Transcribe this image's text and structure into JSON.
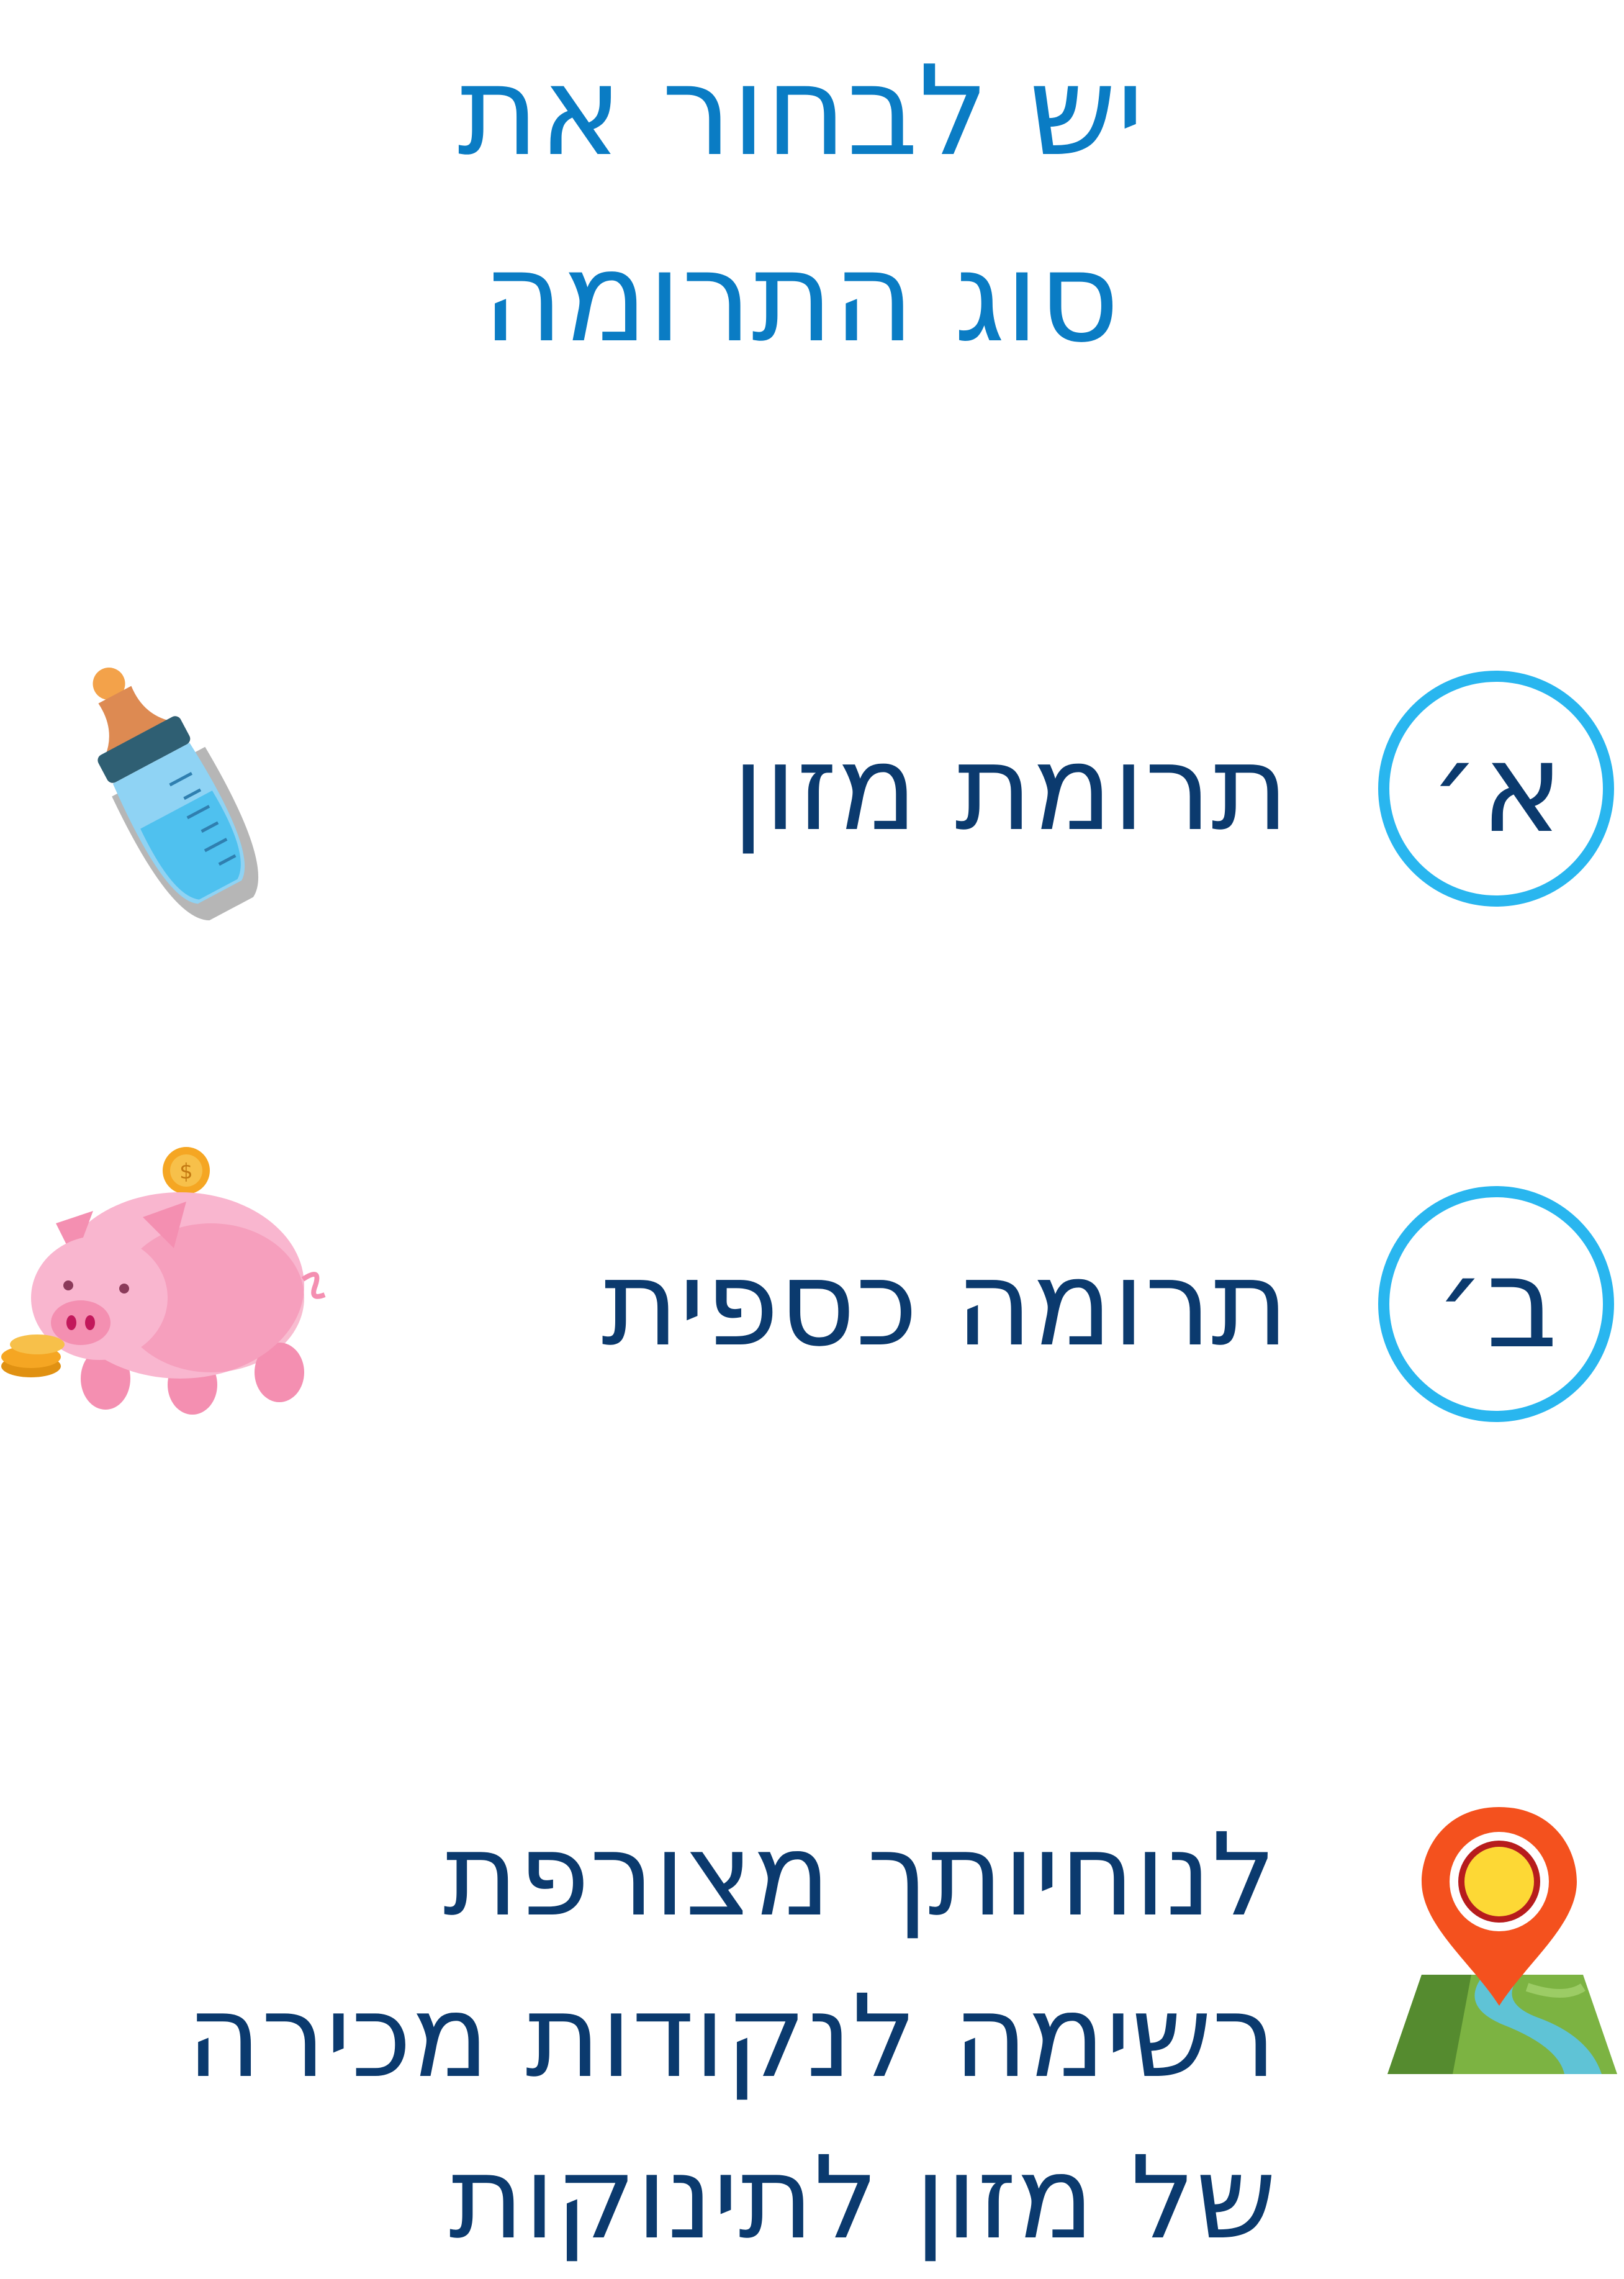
{
  "title": {
    "line1": "יש לבחור את",
    "line2": "סוג התרומה"
  },
  "options": [
    {
      "letter": "א׳",
      "label": "תרומת מזון",
      "icon": "baby-bottle-icon"
    },
    {
      "letter": "ב׳",
      "label": "תרומה כספית",
      "icon": "piggy-bank-icon"
    }
  ],
  "note": {
    "icon": "map-pin-icon",
    "line1": "לנוחיותך מצורפת",
    "line2": "רשימה לנקודות מכירה",
    "line3": "של מזון לתינוקות"
  },
  "colors": {
    "title": "#0a7cc4",
    "text": "#0b3a6e",
    "badge_ring": "#29b6ef"
  }
}
